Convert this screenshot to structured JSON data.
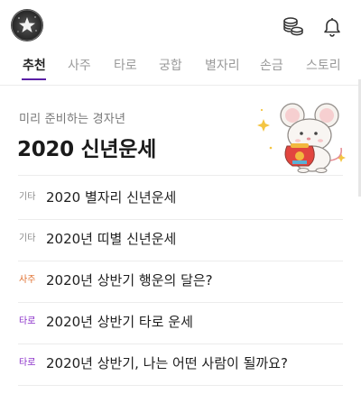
{
  "tabs": [
    {
      "label": "추천",
      "active": true
    },
    {
      "label": "사주",
      "active": false
    },
    {
      "label": "타로",
      "active": false
    },
    {
      "label": "궁합",
      "active": false
    },
    {
      "label": "별자리",
      "active": false
    },
    {
      "label": "손금",
      "active": false
    },
    {
      "label": "스토리",
      "active": false
    }
  ],
  "hero": {
    "subtitle": "미리 준비하는 경자년",
    "title": "2020 신년운세"
  },
  "list": [
    {
      "category": "기타",
      "category_color": "#8c8c8c",
      "title": "2020 별자리 신년운세"
    },
    {
      "category": "기타",
      "category_color": "#8c8c8c",
      "title": "2020년 띠별 신년운세"
    },
    {
      "category": "사주",
      "category_color": "#e0702f",
      "title": "2020년 상반기 행운의 달은?"
    },
    {
      "category": "타로",
      "category_color": "#8a2ec9",
      "title": "2020년 상반기 타로 운세"
    },
    {
      "category": "타로",
      "category_color": "#8a2ec9",
      "title": "2020년 상반기, 나는 어떤 사람이 될까요?"
    }
  ],
  "icons": {
    "avatar": "star-avatar-icon",
    "coins": "coins-icon",
    "notifications": "bell-icon"
  },
  "colors": {
    "accent": "#5a1fa6",
    "orange": "#e0702f",
    "purple": "#8a2ec9"
  }
}
